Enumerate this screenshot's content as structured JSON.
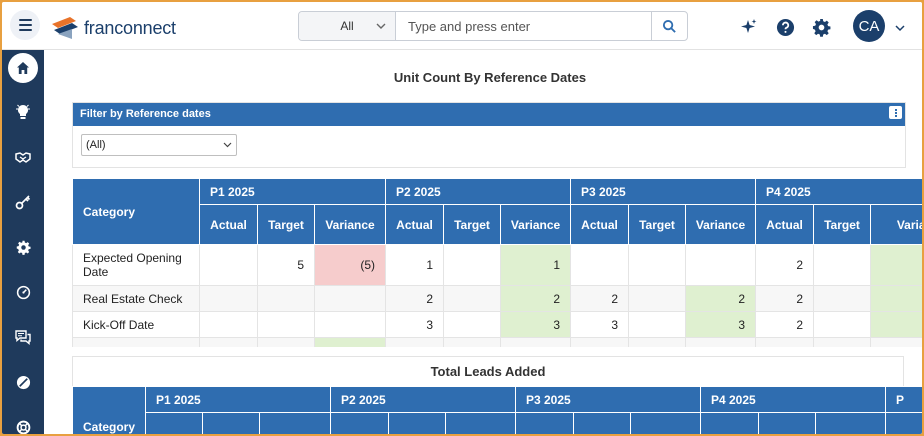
{
  "app": {
    "logo_text": "franconnect"
  },
  "search": {
    "scope": "All",
    "placeholder": "Type and press enter"
  },
  "user": {
    "initials": "CA"
  },
  "colors": {
    "brand": "#1f3a5c",
    "header_blue": "#2f6db0",
    "positive": "#dff0d0",
    "negative": "#f6cccc",
    "border": "#e8a040"
  },
  "sidebar": {
    "items": [
      {
        "name": "home",
        "icon": "home-icon",
        "active": true
      },
      {
        "name": "ideas",
        "icon": "lightbulb-icon"
      },
      {
        "name": "deals",
        "icon": "handshake-icon"
      },
      {
        "name": "keys",
        "icon": "key-icon"
      },
      {
        "name": "settings",
        "icon": "gear-icon"
      },
      {
        "name": "dashboard",
        "icon": "gauge-icon"
      },
      {
        "name": "messages",
        "icon": "chat-icon"
      },
      {
        "name": "analytics",
        "icon": "pie-icon"
      },
      {
        "name": "support",
        "icon": "lifebuoy-icon"
      }
    ]
  },
  "page": {
    "title": "Unit Count By Reference Dates"
  },
  "filter": {
    "header": "Filter by Reference dates",
    "selected": "(All)"
  },
  "unit_table": {
    "category_header": "Category",
    "periods": [
      "P1 2025",
      "P2 2025",
      "P3 2025",
      "P4 2025"
    ],
    "sub_headers": [
      "Actual",
      "Target",
      "Variance"
    ],
    "rows": [
      {
        "category": "Expected Opening Date",
        "cells": [
          "",
          "5",
          "(5)",
          "1",
          "",
          "1",
          "",
          "",
          "",
          "2",
          "",
          ""
        ]
      },
      {
        "category": "Real Estate Check",
        "cells": [
          "",
          "",
          "",
          "2",
          "",
          "2",
          "2",
          "",
          "2",
          "2",
          "",
          ""
        ]
      },
      {
        "category": "Kick-Off Date",
        "cells": [
          "",
          "",
          "",
          "3",
          "",
          "3",
          "3",
          "",
          "3",
          "2",
          "",
          ""
        ]
      }
    ]
  },
  "leads_table": {
    "title": "Total Leads Added",
    "category_header": "Category",
    "periods": [
      "P1 2025",
      "P2 2025",
      "P3 2025",
      "P4 2025",
      "P"
    ]
  }
}
